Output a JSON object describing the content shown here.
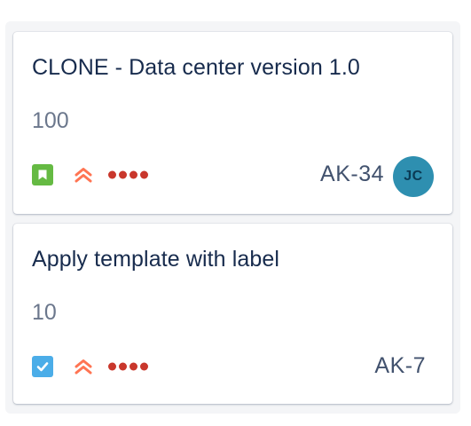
{
  "cards": [
    {
      "summary": "CLONE - Data center version 1.0",
      "story_points": "100",
      "issue_type_icon": "story-bookmark-icon",
      "priority_icon": "priority-high-icon",
      "estimate_icon": "estimate-dots-icon",
      "issue_key": "AK-34",
      "assignee_initials": "JC"
    },
    {
      "summary": "Apply template with label",
      "story_points": "10",
      "issue_type_icon": "task-checkbox-icon",
      "priority_icon": "priority-high-icon",
      "estimate_icon": "estimate-dots-icon",
      "issue_key": "AK-7"
    }
  ],
  "colors": {
    "column_bg": "#f4f5f7",
    "story": "#65ba43",
    "task": "#4bade8",
    "priority": "#ff7452",
    "dots": "#c9372c",
    "avatar": "#2e8fb0",
    "text_primary": "#172b4d",
    "text_secondary": "#6b778c"
  }
}
